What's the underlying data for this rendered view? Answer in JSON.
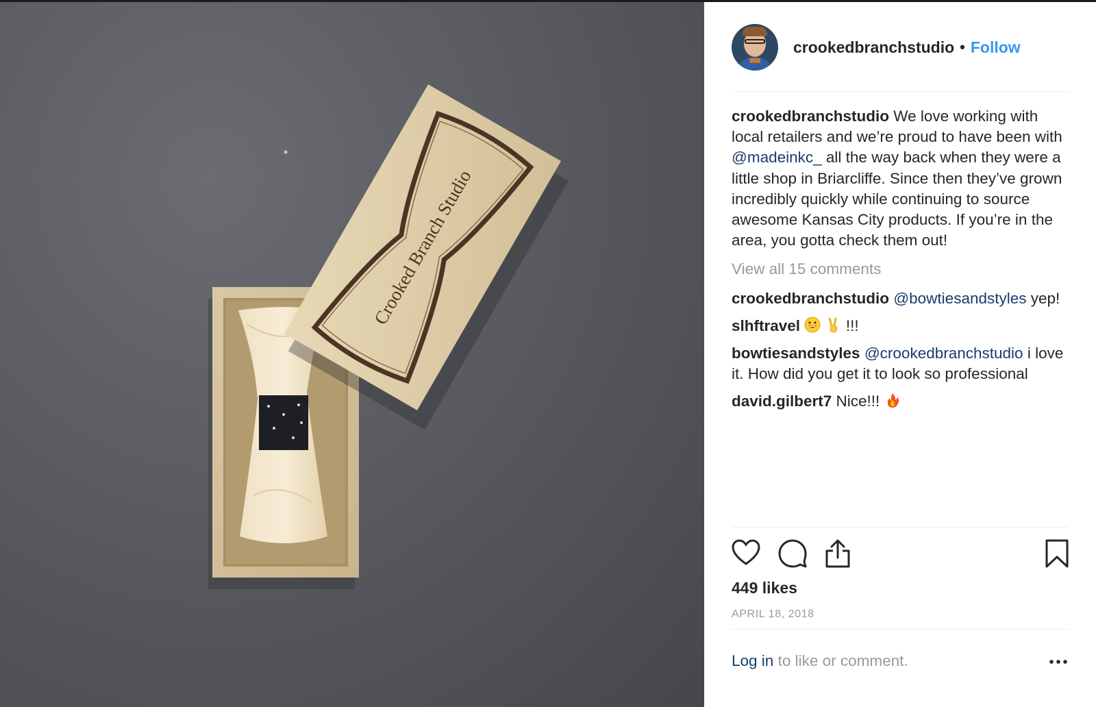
{
  "post": {
    "username": "crookedbranchstudio",
    "separator": "•",
    "follow_label": "Follow",
    "photo_alt_icon": "photo-bowtie-box"
  },
  "caption": {
    "username": "crookedbranchstudio",
    "text_1": " We love working with local retailers and we’re proud to have been with ",
    "mention": "@madeinkc_",
    "text_2": " all the way back when they were a little shop in Briarcliffe. Since then they’ve grown incredibly quickly while continuing to source awesome Kansas City products. If you’re in the area, you gotta check them out!"
  },
  "view_all_comments": "View all 15 comments",
  "comments": [
    {
      "username": "crookedbranchstudio",
      "mention": "@bowtiesandstyles",
      "text": " yep!"
    },
    {
      "username": "slhftravel",
      "text": " !!!",
      "emojis": [
        "grinning-face-emoji",
        "victory-hand-emoji"
      ]
    },
    {
      "username": "bowtiesandstyles",
      "mention": "@crookedbranchstudio",
      "text": " i love it. How did you get it to look so professional"
    },
    {
      "username": "david.gilbert7",
      "text": " Nice!!! ",
      "emojis": [
        "fire-emoji"
      ]
    }
  ],
  "likes": "449 likes",
  "date": "APRIL 18, 2018",
  "footer": {
    "login_label": "Log in",
    "login_suffix": " to like or comment."
  },
  "box_brand_text": "Crooked Branch Studio",
  "colors": {
    "follow_blue": "#3897f0",
    "mention_navy": "#1a3b6e",
    "muted_gray": "#999999",
    "text_dark": "#262626"
  },
  "icons": [
    "heart-icon",
    "comment-icon",
    "share-icon",
    "bookmark-icon",
    "more-options-icon"
  ]
}
